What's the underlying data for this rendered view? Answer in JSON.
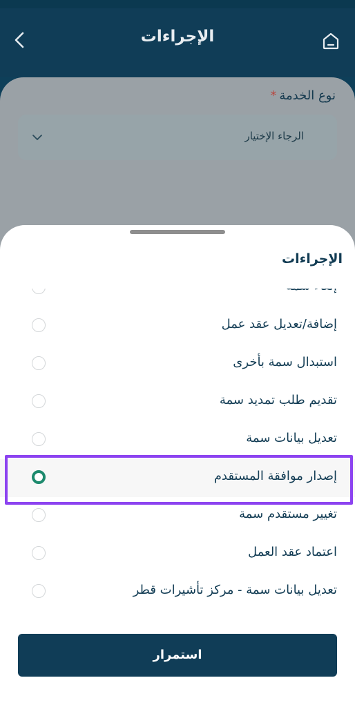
{
  "header": {
    "title": "الإجراءات",
    "back_icon": "chevron-left-icon",
    "home_icon": "home-icon"
  },
  "form": {
    "service_label": "نوع الخدمة",
    "required_mark": "*",
    "select_placeholder": "الرجاء الإختيار"
  },
  "sheet": {
    "title": "الإجراءات",
    "items": [
      {
        "label": "إلغاء سمة",
        "selected": false
      },
      {
        "label": "إضافة/تعديل عقد عمل",
        "selected": false
      },
      {
        "label": "استبدال سمة بأخرى",
        "selected": false
      },
      {
        "label": "تقديم طلب تمديد سمة",
        "selected": false
      },
      {
        "label": "تعديل بيانات سمة",
        "selected": false
      },
      {
        "label": "إصدار موافقة المستقدم",
        "selected": true
      },
      {
        "label": "تغيير مستقدم سمة",
        "selected": false
      },
      {
        "label": "اعتماد عقد العمل",
        "selected": false
      },
      {
        "label": "تعديل بيانات سمة - مركز تأشيرات قطر",
        "selected": false
      }
    ],
    "continue_label": "استمرار"
  },
  "colors": {
    "primary": "#103d57",
    "selected_radio": "#1d8a6d",
    "highlight": "#8c43f0",
    "required": "#b8463f"
  }
}
